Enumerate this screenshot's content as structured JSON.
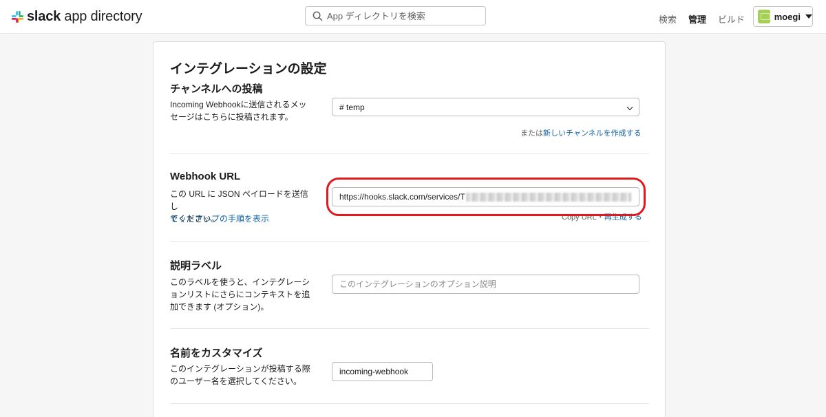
{
  "header": {
    "logo_bold": "slack",
    "logo_rest": " app directory",
    "search_placeholder": "App ディレクトリを検索",
    "nav": {
      "search": "検索",
      "manage": "管理",
      "build": "ビルド"
    },
    "account_name": "moegi"
  },
  "colors": {
    "link": "#1264a3",
    "highlight": "#e0191f",
    "avatar": "#a6cf55"
  },
  "page": {
    "title": "インテグレーションの設定",
    "channel": {
      "title": "チャンネルへの投稿",
      "desc_line1": "Incoming Webhookに送信されるメッ",
      "desc_line2": "セージはこちらに投稿されます。",
      "selected": "# temp",
      "helper_prefix": "または",
      "helper_link": "新しいチャンネルを作成する"
    },
    "webhook": {
      "title": "Webhook URL",
      "desc_line1": "この URL に JSON ペイロードを送信し",
      "desc_line2": "てください。",
      "link": "セットアップの手順を表示",
      "url_visible": "https://hooks.slack.com/services/T",
      "copy": "Copy URL",
      "sep": "・",
      "regen": "再生成する"
    },
    "label": {
      "title": "説明ラベル",
      "desc_line1": "このラベルを使うと、インテグレーシ",
      "desc_line2": "ョンリストにさらにコンテキストを追",
      "desc_line3": "加できます (オプション)。",
      "placeholder": "このインテグレーションのオプション説明"
    },
    "name": {
      "title": "名前をカスタマイズ",
      "desc_line1": "このインテグレーションが投稿する際",
      "desc_line2": "のユーザー名を選択してください。",
      "value": "incoming-webhook"
    }
  },
  "icons": [
    "slack-logo-icon",
    "search-icon",
    "avatar-icon",
    "caret-down-icon",
    "chevron-down-icon"
  ]
}
